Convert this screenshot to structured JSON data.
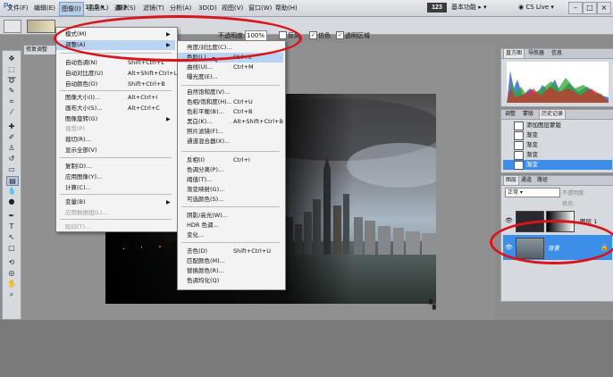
{
  "menubar": {
    "items": [
      "文件(F)",
      "编辑(E)",
      "图像(I)",
      "图层(L)",
      "选择(S)",
      "滤镜(T)",
      "分析(A)",
      "3D(D)",
      "视图(V)",
      "窗口(W)",
      "帮助(H)"
    ],
    "active_index": 2,
    "zoom": "12.5",
    "version_badge": "123",
    "workspace": "基本功能",
    "cs_live": "CS Live"
  },
  "options": {
    "opacity_label": "不透明度:",
    "opacity_value": "100%",
    "reverse_label": "反向",
    "dither_label": "仿色",
    "transparency_label": "透明区域"
  },
  "document": {
    "tab_label": "修复调整"
  },
  "image_menu": {
    "items": [
      {
        "label": "模式(M)",
        "shortcut": "",
        "submenu": true
      },
      {
        "label": "调整(A)",
        "shortcut": "",
        "submenu": true,
        "selected": true
      },
      {
        "label": "自动色调(N)",
        "shortcut": "Shift+Ctrl+L"
      },
      {
        "label": "自动对比度(U)",
        "shortcut": "Alt+Shift+Ctrl+L"
      },
      {
        "label": "自动颜色(O)",
        "shortcut": "Shift+Ctrl+B"
      },
      {
        "label": "图像大小(I)...",
        "shortcut": "Alt+Ctrl+I"
      },
      {
        "label": "画布大小(S)...",
        "shortcut": "Alt+Ctrl+C"
      },
      {
        "label": "图像旋转(G)",
        "shortcut": "",
        "submenu": true
      },
      {
        "label": "裁剪(P)",
        "shortcut": "",
        "disabled": true
      },
      {
        "label": "裁切(R)...",
        "shortcut": ""
      },
      {
        "label": "显示全部(V)",
        "shortcut": ""
      },
      {
        "label": "复制(D)...",
        "shortcut": ""
      },
      {
        "label": "应用图像(Y)...",
        "shortcut": ""
      },
      {
        "label": "计算(C)...",
        "shortcut": ""
      },
      {
        "label": "变量(B)",
        "shortcut": "",
        "submenu": true
      },
      {
        "label": "应用数据组(L)...",
        "shortcut": "",
        "disabled": true
      },
      {
        "label": "陷印(T)...",
        "shortcut": "",
        "disabled": true
      }
    ]
  },
  "adjust_menu": {
    "items": [
      {
        "label": "亮度/对比度(C)...",
        "shortcut": ""
      },
      {
        "label": "色阶(L)...",
        "shortcut": "Ctrl+L",
        "selected": true
      },
      {
        "label": "曲线(U)...",
        "shortcut": "Ctrl+M"
      },
      {
        "label": "曝光度(E)...",
        "shortcut": ""
      },
      {
        "label": "自然饱和度(V)...",
        "shortcut": ""
      },
      {
        "label": "色相/饱和度(H)...",
        "shortcut": "Ctrl+U"
      },
      {
        "label": "色彩平衡(B)...",
        "shortcut": "Ctrl+B"
      },
      {
        "label": "黑白(K)...",
        "shortcut": "Alt+Shift+Ctrl+B"
      },
      {
        "label": "照片滤镜(F)...",
        "shortcut": ""
      },
      {
        "label": "通道混合器(X)...",
        "shortcut": ""
      },
      {
        "label": "反相(I)",
        "shortcut": "Ctrl+I"
      },
      {
        "label": "色调分离(P)...",
        "shortcut": ""
      },
      {
        "label": "阈值(T)...",
        "shortcut": ""
      },
      {
        "label": "渐变映射(G)...",
        "shortcut": ""
      },
      {
        "label": "可选颜色(S)...",
        "shortcut": ""
      },
      {
        "label": "阴影/高光(W)...",
        "shortcut": ""
      },
      {
        "label": "HDR 色调...",
        "shortcut": ""
      },
      {
        "label": "变化...",
        "shortcut": ""
      },
      {
        "label": "去色(D)",
        "shortcut": "Shift+Ctrl+U"
      },
      {
        "label": "匹配颜色(M)...",
        "shortcut": ""
      },
      {
        "label": "替换颜色(R)...",
        "shortcut": ""
      },
      {
        "label": "色调均化(Q)",
        "shortcut": ""
      }
    ]
  },
  "histogram_panel": {
    "tabs": [
      "直方图",
      "导航器",
      "信息"
    ]
  },
  "history_panel": {
    "tabs": [
      "调整",
      "蒙版",
      "历史记录"
    ],
    "items": [
      "添加图层蒙版",
      "渐变",
      "渐变",
      "渐变",
      "渐变"
    ],
    "selected_index": 4
  },
  "layers_panel": {
    "tabs": [
      "图层",
      "通道",
      "路径"
    ],
    "blend_mode": "正常",
    "opacity_label": "不透明度:",
    "fill_label": "填充:",
    "layers": [
      {
        "name": "图层 1",
        "selected": false
      },
      {
        "name": "背景",
        "selected": true
      }
    ]
  },
  "colors": {
    "selection": "#b9d3f2",
    "annotation_ring": "#d9141b",
    "layer_selected": "#3d8ee8"
  }
}
